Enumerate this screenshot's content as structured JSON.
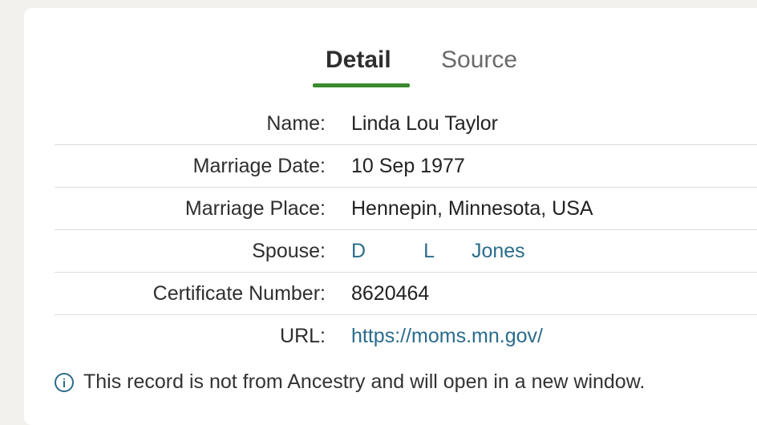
{
  "tabs": {
    "detail_label": "Detail",
    "source_label": "Source"
  },
  "record": {
    "name_label": "Name:",
    "name_value": "Linda Lou Taylor",
    "date_label": "Marriage Date:",
    "date_value": "10 Sep 1977",
    "place_label": "Marriage Place:",
    "place_value": "Hennepin, Minnesota, USA",
    "spouse_label": "Spouse:",
    "spouse_first": "D",
    "spouse_middle": "L",
    "spouse_last": "Jones",
    "certificate_label": "Certificate Number:",
    "certificate_value": "8620464",
    "url_label": "URL:",
    "url_value": "https://moms.mn.gov/"
  },
  "footnote": {
    "icon": "info-icon",
    "text": "This record is not from Ancestry and will open in a new window."
  },
  "colors": {
    "link": "#2a6c8c",
    "active_tab_underline": "#3a8a2e",
    "page_background": "#f3f1ee"
  }
}
